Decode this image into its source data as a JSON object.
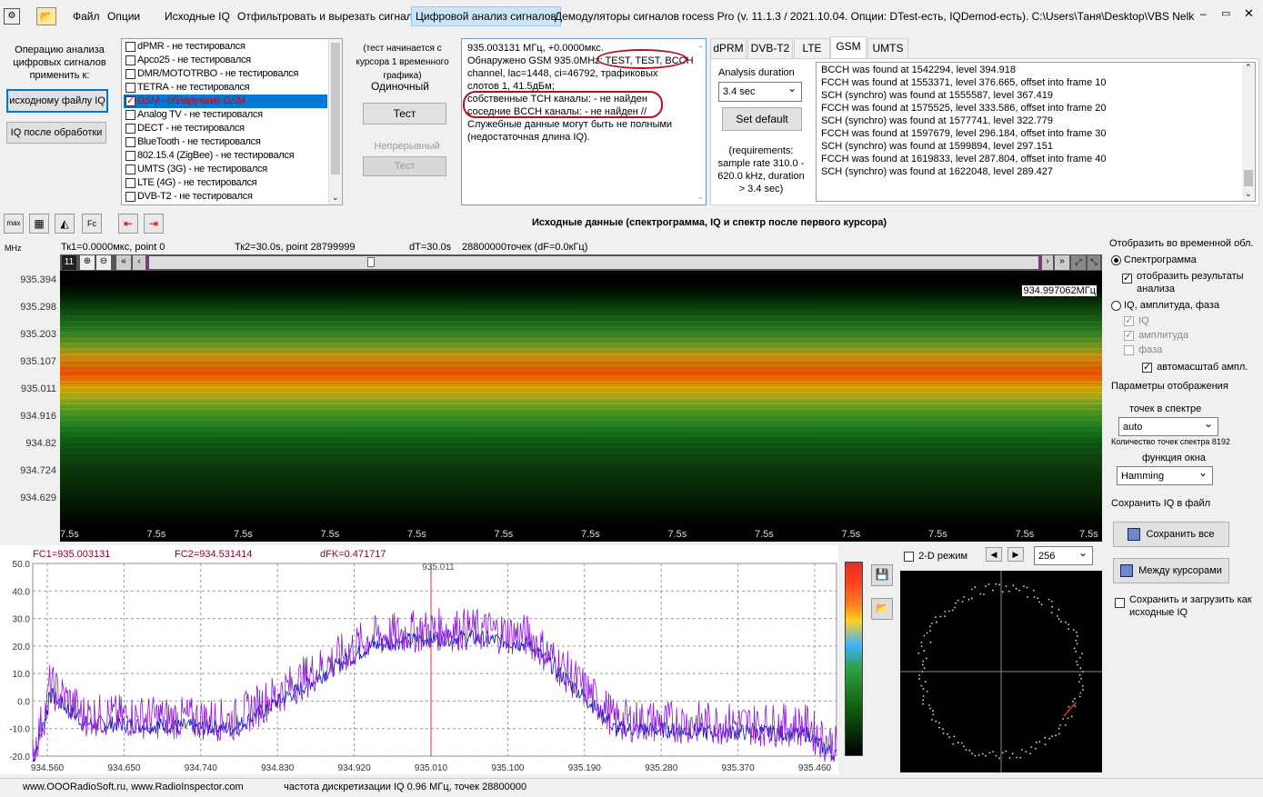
{
  "menu": {
    "file": "Файл",
    "options": "Опции",
    "source_iq": "Исходные IQ",
    "filter_cut": "Отфильтровать и вырезать сигнал",
    "digital_analysis": "Цифровой анализ сигналов",
    "demodulators": "Демодуляторы сигналов",
    "title": "rocess Pro (v. 11.1.3 / 2021.10.04. Опции: DTest-есть, IQDemod-есть). C:\\Users\\Таня\\Desktop\\VBS Nelk Mayak 2 2.("
  },
  "left_panel": {
    "caption": "Операцию анализа цифровых сигналов применить к:",
    "btn_source": "исходному файлу IQ",
    "btn_processed": "IQ после обработки"
  },
  "protocols": [
    {
      "label": "dPMR - не тестировался",
      "checked": false
    },
    {
      "label": "Apco25 - не тестировался",
      "checked": false
    },
    {
      "label": "DMR/MOTOTRBO - не тестировался",
      "checked": false
    },
    {
      "label": "TETRA - не тестировался",
      "checked": false
    },
    {
      "label": "GSM - обнаружено GSM",
      "checked": true,
      "selected": true
    },
    {
      "label": "Analog TV - не тестировался",
      "checked": false
    },
    {
      "label": "DECT - не тестировался",
      "checked": false
    },
    {
      "label": "BlueTooth - не тестировался",
      "checked": false
    },
    {
      "label": "802.15.4 (ZigBee) - не тестировался",
      "checked": false
    },
    {
      "label": "UMTS (3G) - не тестировался",
      "checked": false
    },
    {
      "label": "LTE (4G) - не тестировался",
      "checked": false
    },
    {
      "label": "DVB-T2 - не тестировался",
      "checked": false
    }
  ],
  "test_panel": {
    "note": "(тест начинается с курсора 1 временного графика)",
    "single": "Одиночный",
    "test_btn": "Тест",
    "continuous": "Непрерывный",
    "test_btn2": "Тест"
  },
  "result_text": {
    "l1": "935.003131 МГц,  +0.0000мкс.",
    "l2": "Обнаружено GSM 935.0MHz: TEST, TEST, BCCH",
    "l3": "channel, lac=1448, ci=46792,  трафиковых",
    "l4": "слотов 1, 41.5дБм;",
    "l5": "собственные TCH каналы: - не найден",
    "l6": "соседние BCCH каналы: - не найден //",
    "l7": "Служебные данные могут быть не полными",
    "l8": "(недостаточная длина IQ)."
  },
  "tabs": [
    "dPRM",
    "DVB-T2",
    "LTE",
    "GSM",
    "UMTS"
  ],
  "analysis": {
    "duration_label": "Analysis duration",
    "duration_value": "3.4 sec",
    "set_default": "Set default",
    "requirements": "(requirements: sample rate 310.0 - 620.0 kHz, duration > 3.4 sec)"
  },
  "log": [
    "BCCH was found at 1542294, level 394.918",
    "FCCH was found at 1553371, level 376.665, offset into frame 10",
    "SCH (synchro) was found at 1555587, level 367.419",
    "FCCH was found at 1575525, level 333.586, offset into frame 20",
    "SCH (synchro) was found at 1577741, level 322.779",
    "FCCH was found at 1597679, level 296.184, offset into frame 30",
    "SCH (synchro) was found at 1599894, level 297.151",
    "FCCH was found at 1619833, level 287.804, offset into frame 40",
    "SCH (synchro) was found at 1622048, level 289.427"
  ],
  "spectrogram": {
    "heading": "Исходные данные (спектрограмма, IQ и спектр после первого курсора)",
    "unit": "MHz",
    "tk1": "Тк1=0.0000мкс, point 0",
    "tk2": "Тк2=30.0s, point 28799999",
    "dt": "dT=30.0s",
    "points": "28800000точек (dF=0.0кГц)",
    "freq_marker": "934.997062МГц",
    "yticks": [
      "935.394",
      "935.298",
      "935.203",
      "935.107",
      "935.011",
      "934.916",
      "934.82",
      "934.724",
      "934.629"
    ],
    "xtick": "7.5s",
    "scroll_num": "11"
  },
  "spectrum": {
    "fc1": "FC1=935.003131",
    "fc2": "FC2=934.531414",
    "dfk": "dFK=0.471717",
    "marker": "935.011",
    "yticks": [
      "50.0",
      "40.0",
      "30.0",
      "20.0",
      "10.0",
      "0.0",
      "-10.0",
      "-20.0"
    ],
    "xticks": [
      "934.560",
      "934.650",
      "934.740",
      "934.830",
      "934.920",
      "935.010",
      "935.100",
      "935.190",
      "935.280",
      "935.370",
      "935.460"
    ],
    "colors": {
      "blue": "#1010c0",
      "purple": "#8a1ad0",
      "cursor": "#e03030"
    }
  },
  "constellation": {
    "mode_2d": "2-D режим",
    "points": "256"
  },
  "right_panel": {
    "display_title": "Отобразить во временной обл.",
    "spectrogram": "Спектрограмма",
    "show_results": "отобразить результаты анализа",
    "iq_amp_phase": "IQ, амплитуда, фаза",
    "iq": "IQ",
    "amplitude": "амплитуда",
    "phase": "фаза",
    "autoscale": "автомасштаб ампл.",
    "display_params": "Параметры отображения",
    "points_label": "точек в спектре",
    "points_value": "auto",
    "spectrum_points": "Количество точек спектра 8192",
    "window_label": "функция окна",
    "window_value": "Hamming",
    "save_title": "Сохранить IQ в файл",
    "save_all": "Сохранить все",
    "between": "Между курсорами",
    "save_load": "Сохранить и загрузить как исходные IQ"
  },
  "status": {
    "site": "www.OOORadioSoft.ru, www.RadioInspector.com",
    "info": "частота дискретизации IQ 0.96 МГц, точек 28800000"
  }
}
